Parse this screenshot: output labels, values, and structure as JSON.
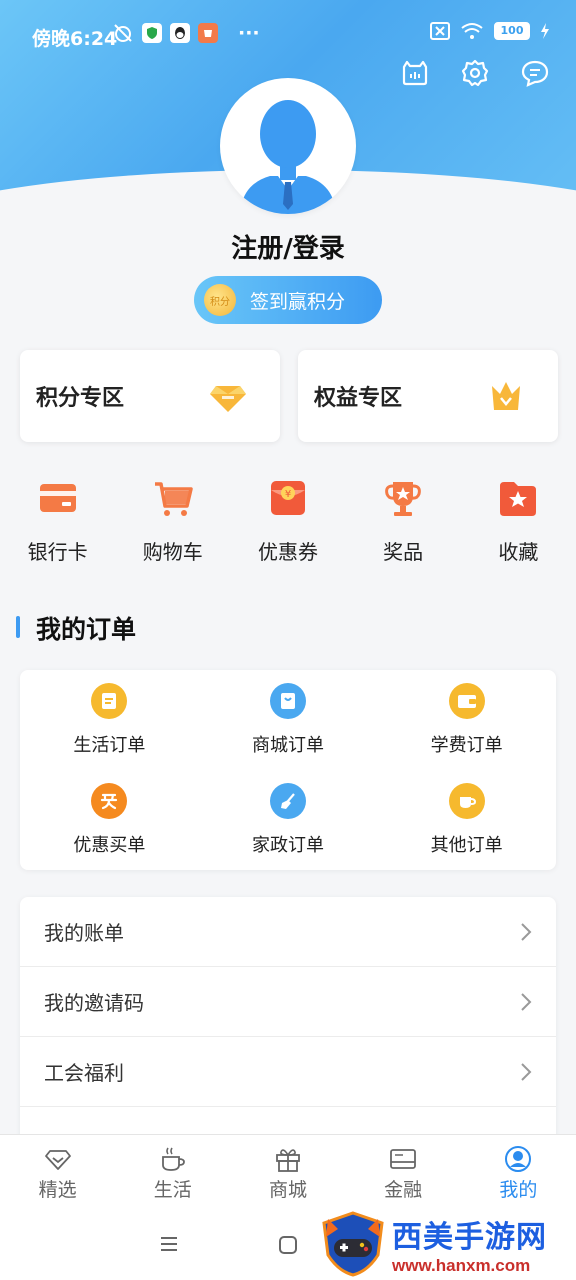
{
  "status_bar": {
    "time": "傍晚6:24",
    "more": "···",
    "battery": "100"
  },
  "profile": {
    "login_text": "注册/登录",
    "signin_label": "签到赢积分",
    "coin_text": "积分"
  },
  "zones": [
    {
      "label": "积分专区"
    },
    {
      "label": "权益专区"
    }
  ],
  "quick_items": [
    {
      "label": "银行卡"
    },
    {
      "label": "购物车"
    },
    {
      "label": "优惠券"
    },
    {
      "label": "奖品"
    },
    {
      "label": "收藏"
    }
  ],
  "orders": {
    "title": "我的订单",
    "items": [
      {
        "label": "生活订单"
      },
      {
        "label": "商城订单"
      },
      {
        "label": "学费订单"
      },
      {
        "label": "优惠买单"
      },
      {
        "label": "家政订单"
      },
      {
        "label": "其他订单"
      }
    ]
  },
  "menu": [
    {
      "label": "我的账单"
    },
    {
      "label": "我的邀请码"
    },
    {
      "label": "工会福利"
    }
  ],
  "bottom_nav": [
    {
      "label": "精选"
    },
    {
      "label": "生活"
    },
    {
      "label": "商城"
    },
    {
      "label": "金融"
    },
    {
      "label": "我的"
    }
  ],
  "watermark": {
    "title": "西美手游网",
    "url": "www.hanxm.com"
  },
  "colors": {
    "accent": "#2b8cef",
    "header_gradient_start": "#6cc6f7",
    "header_gradient_end": "#4aa8f0"
  }
}
